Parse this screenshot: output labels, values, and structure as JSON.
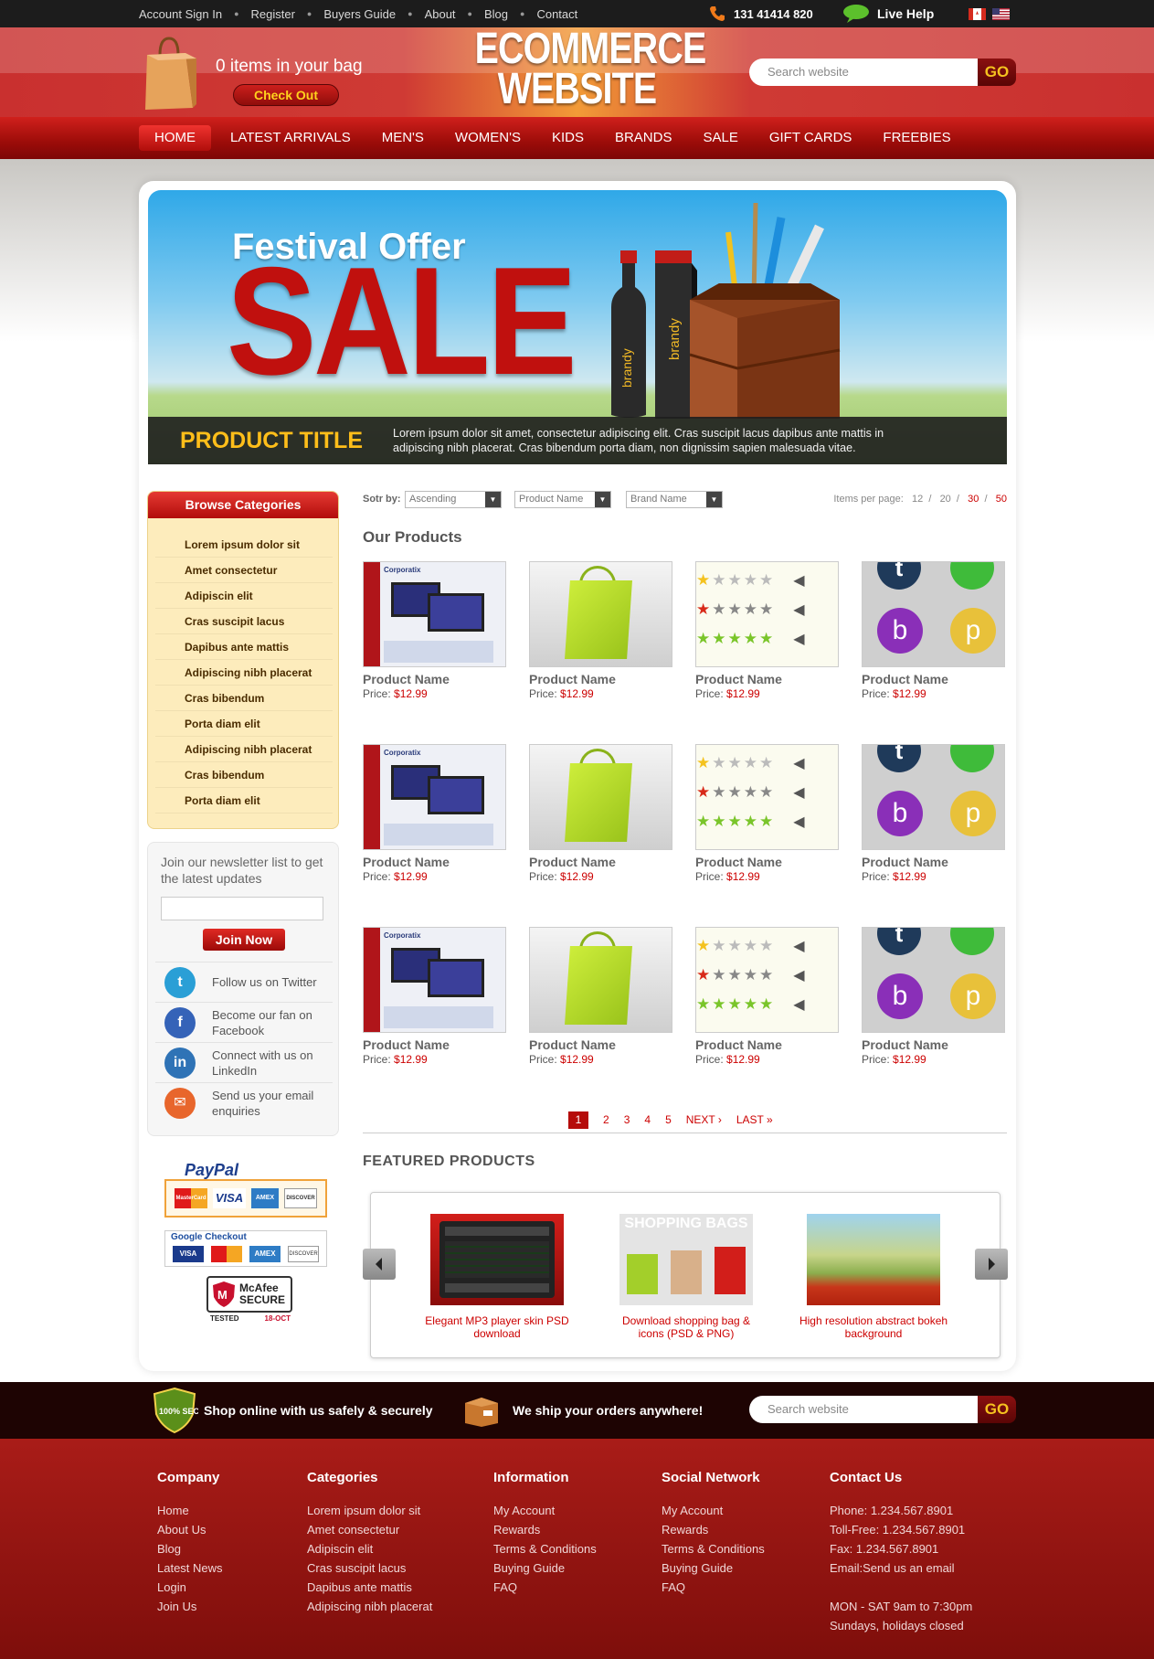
{
  "topbar": {
    "links": [
      "Account Sign In",
      "Register",
      "Buyers Guide",
      "About",
      "Blog",
      "Contact"
    ],
    "phone": "131 41414 820",
    "live_help": "Live Help"
  },
  "header": {
    "bag_text": "0 items in your bag",
    "checkout_label": "Check Out",
    "logo_line1": "ECOMMERCE",
    "logo_line2": "WEBSITE",
    "search_placeholder": "Search website",
    "search_button": "GO"
  },
  "nav": [
    "HOME",
    "LATEST ARRIVALS",
    "MEN'S",
    "WOMEN'S",
    "KIDS",
    "BRANDS",
    "SALE",
    "GIFT CARDS",
    "FREEBIES"
  ],
  "banner": {
    "festival": "Festival Offer",
    "sale": "SALE",
    "bottle_label": "brandy",
    "product_title": "PRODUCT TITLE",
    "product_desc": "Lorem ipsum dolor sit amet, consectetur adipiscing elit. Cras suscipit lacus dapibus ante mattis in adipiscing nibh placerat. Cras bibendum porta diam, non dignissim sapien malesuada vitae."
  },
  "sidebar": {
    "browse_title": "Browse Categories",
    "categories": [
      "Lorem ipsum dolor sit",
      "Amet consectetur",
      "Adipiscin elit",
      "Cras suscipit lacus",
      "Dapibus ante mattis",
      "Adipiscing nibh placerat",
      "Cras bibendum",
      "Porta diam elit",
      "Adipiscing nibh placerat",
      "Cras bibendum",
      "Porta diam elit"
    ],
    "newsletter_text": "Join our newsletter list to get the latest updates",
    "join_label": "Join Now",
    "social": [
      {
        "icon": "twitter-icon",
        "label": "Follow us on Twitter",
        "color": "#2a9fd6"
      },
      {
        "icon": "facebook-icon",
        "label": "Become our fan on Facebook",
        "color": "#3563b8"
      },
      {
        "icon": "linkedin-icon",
        "label": "Connect with us on LinkedIn",
        "color": "#2f73b6"
      },
      {
        "icon": "email-icon",
        "label": "Send us your email enquiries",
        "color": "#e8662c"
      }
    ],
    "payments": {
      "paypal": "PayPal",
      "cards": [
        "MasterCard",
        "VISA",
        "AMEX",
        "DISCOVER"
      ],
      "google_checkout": "Google Checkout",
      "mcafee_secure": "McAfee SECURE",
      "mcafee_tested": "TESTED",
      "mcafee_date": "18-OCT"
    }
  },
  "sort": {
    "label": "Sotr by:",
    "options": [
      "Ascending",
      "Product Name",
      "Brand Name"
    ],
    "per_page_label": "Items per page:",
    "per_page": [
      "12",
      "20",
      "30",
      "50"
    ]
  },
  "products": {
    "title": "Our Products",
    "items": [
      {
        "name": "Product Name",
        "price_label": "Price:",
        "price": "$12.99",
        "image": "monitor-image"
      },
      {
        "name": "Product Name",
        "price_label": "Price:",
        "price": "$12.99",
        "image": "bag-image"
      },
      {
        "name": "Product Name",
        "price_label": "Price:",
        "price": "$12.99",
        "image": "stars-image"
      },
      {
        "name": "Product Name",
        "price_label": "Price:",
        "price": "$12.99",
        "image": "social-image"
      },
      {
        "name": "Product Name",
        "price_label": "Price:",
        "price": "$12.99",
        "image": "monitor-image"
      },
      {
        "name": "Product Name",
        "price_label": "Price:",
        "price": "$12.99",
        "image": "bag-image"
      },
      {
        "name": "Product Name",
        "price_label": "Price:",
        "price": "$12.99",
        "image": "stars-image"
      },
      {
        "name": "Product Name",
        "price_label": "Price:",
        "price": "$12.99",
        "image": "social-image"
      },
      {
        "name": "Product Name",
        "price_label": "Price:",
        "price": "$12.99",
        "image": "monitor-image"
      },
      {
        "name": "Product Name",
        "price_label": "Price:",
        "price": "$12.99",
        "image": "bag-image"
      },
      {
        "name": "Product Name",
        "price_label": "Price:",
        "price": "$12.99",
        "image": "stars-image"
      },
      {
        "name": "Product Name",
        "price_label": "Price:",
        "price": "$12.99",
        "image": "social-image"
      }
    ],
    "monitor_brand": "Corporatix"
  },
  "pagination": {
    "pages": [
      "1",
      "2",
      "3",
      "4",
      "5"
    ],
    "current": "1",
    "next": "NEXT ›",
    "last": "LAST »"
  },
  "featured": {
    "title": "FEATURED PRODUCTS",
    "items": [
      {
        "caption": "Elegant MP3 player skin PSD download"
      },
      {
        "caption": "Download shopping bag & icons (PSD & PNG)",
        "image_text": "SHOPPING BAGS"
      },
      {
        "caption": "High resolution abstract bokeh background"
      }
    ]
  },
  "footer_strip": {
    "secure_badge": "100% SECURED",
    "secure_text": "Shop online with us safely & securely",
    "ship_text": "We ship your orders anywhere!",
    "search_placeholder": "Search website",
    "search_button": "GO"
  },
  "footer": {
    "company": {
      "title": "Company",
      "links": [
        "Home",
        "About Us",
        "Blog",
        "Latest News",
        "Login",
        "Join Us"
      ]
    },
    "categories": {
      "title": "Categories",
      "links": [
        "Lorem ipsum dolor sit",
        "Amet consectetur",
        "Adipiscin elit",
        "Cras suscipit lacus",
        "Dapibus ante mattis",
        "Adipiscing nibh placerat"
      ]
    },
    "information": {
      "title": "Information",
      "links": [
        "My Account",
        "Rewards",
        "Terms & Conditions",
        "Buying Guide",
        "FAQ"
      ]
    },
    "social": {
      "title": "Social Network",
      "links": [
        "My Account",
        "Rewards",
        "Terms & Conditions",
        "Buying Guide",
        "FAQ"
      ]
    },
    "contact": {
      "title": "Contact Us",
      "lines": [
        "Phone: 1.234.567.8901",
        "Toll-Free: 1.234.567.8901",
        "Fax: 1.234.567.8901",
        "Email:Send us an email",
        "",
        "MON - SAT 9am to 7:30pm",
        "Sundays, holidays closed"
      ]
    }
  },
  "colors": {
    "brand_red": "#b50c0a",
    "accent_yellow": "#ffbe1a",
    "price_red": "#cc0000"
  }
}
